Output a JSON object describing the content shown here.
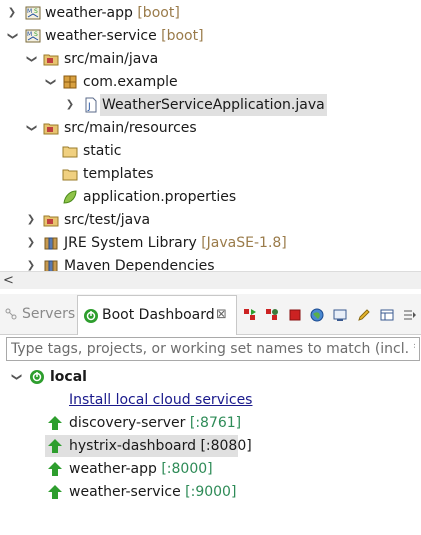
{
  "explorer": {
    "items": [
      {
        "label": "weather-app",
        "decoration": "[boot]"
      },
      {
        "label": "weather-service",
        "decoration": "[boot]"
      },
      {
        "label": "src/main/java"
      },
      {
        "label": "com.example"
      },
      {
        "label": "WeatherServiceApplication.java"
      },
      {
        "label": "src/main/resources"
      },
      {
        "label": "static"
      },
      {
        "label": "templates"
      },
      {
        "label": "application.properties"
      },
      {
        "label": "src/test/java"
      },
      {
        "label": "JRE System Library",
        "decoration": "[JavaSE-1.8]"
      },
      {
        "label": "Maven Dependencies"
      }
    ],
    "scroll_left_glyph": "<"
  },
  "tabs": {
    "servers_label": "Servers",
    "dashboard_label": "Boot Dashboard",
    "close_glyph": "⊠"
  },
  "filter": {
    "placeholder": "Type tags, projects, or working set names to match (incl. * and"
  },
  "dashboard": {
    "group_label": "local",
    "install_link": "Install local cloud services",
    "apps": [
      {
        "name": "discovery-server",
        "port": "[:8761]"
      },
      {
        "name": "hystrix-dashboard",
        "port": "[:8080]"
      },
      {
        "name": "weather-app",
        "port": "[:8000]"
      },
      {
        "name": "weather-service",
        "port": "[:9000]"
      }
    ]
  },
  "colors": {
    "boot_green": "#2e9e2e",
    "folder_brown": "#c8a24a",
    "link_blue": "#1a1a8c",
    "port_green": "#2e8b57",
    "selection_gray": "#e0e0e0"
  }
}
